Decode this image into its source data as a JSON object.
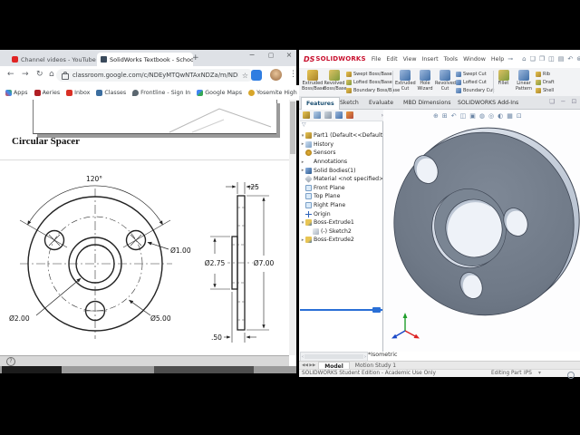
{
  "browser": {
    "tab1": "Channel videos - YouTube Studio",
    "tab2": "SolidWorks Textbook - School U...",
    "new_tab": "+",
    "close_glyph": "×",
    "min_glyph": "−",
    "max_glyph": "▢",
    "back": "←",
    "forward": "→",
    "reload": "↻",
    "home": "⌂",
    "url": "classroom.google.com/c/NDEyMTQwNTAxNDZa/m/NDEyMTQwNTA...",
    "star": "☆",
    "menu_dots": "⋮",
    "bookmarks": [
      "Apps",
      "Aeries",
      "Inbox",
      "Classes",
      "Frontline - Sign In",
      "Google Maps",
      "Yosemite High Sierr...",
      "»"
    ],
    "page": {
      "heading": "Circular Spacer",
      "help": "?",
      "dims": {
        "angle": "120°",
        "d1": "Ø1.00",
        "d2": "Ø2.00",
        "d5": "Ø5.00",
        "t25": ".25",
        "d275": "Ø2.75",
        "d7": "Ø7.00",
        "t50": ".50"
      }
    }
  },
  "sw": {
    "brand_prefix": "DS",
    "brand": "SOLIDWORKS",
    "menus": [
      "File",
      "Edit",
      "View",
      "Insert",
      "Tools",
      "Window",
      "Help"
    ],
    "cm": {
      "big": [
        {
          "l": "Extruded\nBoss/Base"
        },
        {
          "l": "Revolved\nBoss/Base"
        },
        {
          "l": "Extruded\nCut"
        },
        {
          "l": "Hole\nWizard"
        },
        {
          "l": "Revolved\nCut"
        },
        {
          "l": "Fillet"
        },
        {
          "l": "Linear\nPattern"
        }
      ],
      "stack1": [
        "Swept Boss/Base",
        "Lofted Boss/Base",
        "Boundary Boss/Base"
      ],
      "stack2": [
        "Swept Cut",
        "Lofted Cut",
        "Boundary Cut"
      ],
      "stack3": [
        "Rib",
        "Draft",
        "Shell"
      ]
    },
    "tabs": [
      "Features",
      "Sketch",
      "Evaluate",
      "MBD Dimensions",
      "SOLIDWORKS Add-Ins"
    ],
    "tree": [
      "Part1 (Default<<Default>_Displ",
      "History",
      "Sensors",
      "Annotations",
      "Solid Bodies(1)",
      "Material <not specified>",
      "Front Plane",
      "Top Plane",
      "Right Plane",
      "Origin",
      "Boss-Extrude1",
      "(-) Sketch2",
      "Boss-Extrude2"
    ],
    "view_label": "*Isometric",
    "doc_tabs": [
      "Model",
      "Motion Study 1"
    ],
    "status": {
      "left": "SOLIDWORKS Student Edition - Academic Use Only",
      "mode": "Editing Part",
      "units": "IPS"
    },
    "colors": {
      "accent_red": "#c8102e",
      "rollback_blue": "#2a6fd6",
      "disc_gray": "#6f7987"
    }
  }
}
